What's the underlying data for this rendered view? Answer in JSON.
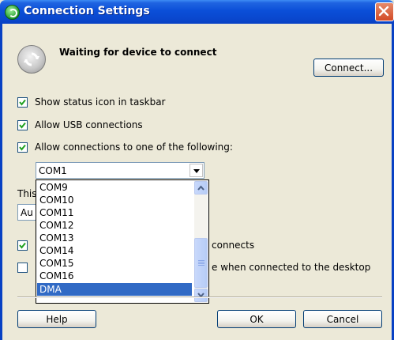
{
  "window": {
    "title": "Connection Settings"
  },
  "status": {
    "text": "Waiting for device to connect"
  },
  "buttons": {
    "connect": "Connect...",
    "help": "Help",
    "ok": "OK",
    "cancel": "Cancel"
  },
  "options": {
    "show_status_icon": {
      "label": "Show status icon in taskbar",
      "checked": true
    },
    "allow_usb": {
      "label": "Allow USB connections",
      "checked": true
    },
    "allow_connections": {
      "label": "Allow connections to one of the following:",
      "checked": true
    }
  },
  "combo": {
    "selected": "COM1",
    "items": [
      "COM9",
      "COM10",
      "COM11",
      "COM12",
      "COM13",
      "COM14",
      "COM15",
      "COM16",
      "DMA"
    ],
    "highlighted": "DMA"
  },
  "partial": {
    "this_label": "This",
    "select_value": "Au",
    "checkbox4_fragment": "connects",
    "checkbox5_fragment": "e when connected to the desktop",
    "checkbox4_checked": true,
    "checkbox5_checked": false
  },
  "colors": {
    "titlebar": "#0a48cf",
    "selection": "#316ac5",
    "dialog": "#ece9d8"
  }
}
